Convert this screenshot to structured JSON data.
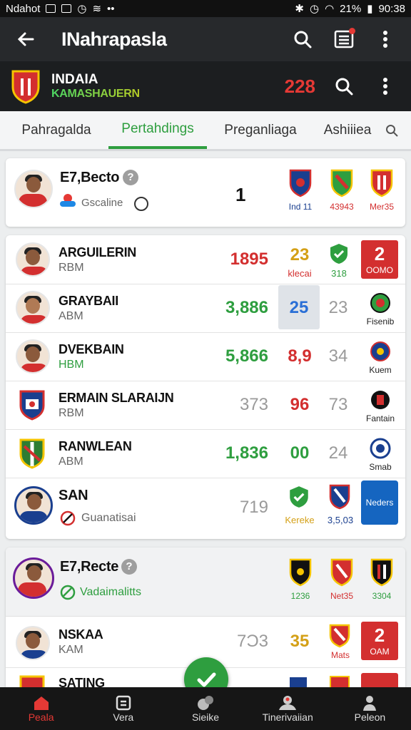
{
  "status_bar": {
    "left_text": "Ndahot",
    "battery": "21%",
    "time": "90:38"
  },
  "app_bar": {
    "title": "INahrapasla"
  },
  "team_header": {
    "line1": "INDAIA",
    "line2": "KAMASHAUERN",
    "score": "228"
  },
  "tabs": [
    {
      "label": "Pahragalda",
      "active": false
    },
    {
      "label": "Pertahdings",
      "active": true
    },
    {
      "label": "Preganliaga",
      "active": false
    },
    {
      "label": "Ashiiiea",
      "active": false
    }
  ],
  "card1": {
    "title": "E7,Becto",
    "status": "Gscaline",
    "count": "1",
    "badges": [
      {
        "caption": "Ind 11",
        "color": "#1a3f8f"
      },
      {
        "caption": "43943",
        "color": "#d32f2f"
      },
      {
        "caption": "Mer35",
        "color": "#d32f2f"
      }
    ]
  },
  "players": [
    {
      "name": "ARGUILERIN",
      "team": "RBM",
      "stat1": "1895",
      "stat1_color": "#d32f2f",
      "stat2": "23",
      "stat2_color": "#d4a017",
      "stat2_caption": "klecai",
      "stat3_caption": "318",
      "badge_num": "2",
      "badge_label": "OOMO"
    },
    {
      "name": "GRAYBAII",
      "team": "ABM",
      "stat1": "3,886",
      "stat1_color": "#2e9e3f",
      "stat2": "25",
      "stat2_color": "#2a6fd6",
      "stat3": "23",
      "badge_caption": "Fisenib"
    },
    {
      "name": "DVEKBAIN",
      "team": "HBM",
      "stat1": "5,866",
      "stat1_color": "#2e9e3f",
      "stat2": "8,9",
      "stat2_color": "#d32f2f",
      "stat3": "34",
      "badge_caption": "Kuem"
    },
    {
      "name": "ERMAIN SLARAIJN",
      "team": "RBM",
      "stat1": "373",
      "stat1_color": "#9a9a9a",
      "stat2": "96",
      "stat2_color": "#d32f2f",
      "stat3": "73",
      "badge_caption": "Fantain"
    },
    {
      "name": "RANWLEAN",
      "team": "ABM",
      "stat1": "1,836",
      "stat1_color": "#2e9e3f",
      "stat2": "00",
      "stat2_color": "#2e9e3f",
      "stat3": "24",
      "badge_caption": "Smab"
    },
    {
      "name": "SAN",
      "team": "Guanatisai",
      "stat1": "719",
      "stat1_color": "#9a9a9a",
      "stat2_caption": "Kereke",
      "stat3_caption": "3,5,03",
      "badge_label": "Neders"
    }
  ],
  "card2": {
    "title": "E7,Recte",
    "status": "Vadaimalitts",
    "badges": [
      {
        "caption": "1236",
        "color": "#111"
      },
      {
        "caption": "Net35",
        "color": "#d32f2f"
      },
      {
        "caption": "3304",
        "color": "#111"
      }
    ],
    "rows": [
      {
        "name": "NSKAA",
        "team": "KAM",
        "stat1": "7Ɔ3",
        "stat2": "35",
        "stat2_caption": "Mats",
        "badge_num": "2",
        "badge_label": "OAM"
      },
      {
        "name": "SATING",
        "team": "",
        "stat1": "",
        "stat2": ""
      }
    ]
  },
  "bottom_nav": [
    {
      "label": "Peala",
      "icon": "home-icon",
      "active": true
    },
    {
      "label": "Vera",
      "icon": "calendar-icon",
      "active": false
    },
    {
      "label": "Sieike",
      "icon": "ball-icon",
      "active": false
    },
    {
      "label": "Tinerivaiian",
      "icon": "profile-card-icon",
      "active": false
    },
    {
      "label": "Peleon",
      "icon": "person-icon",
      "active": false
    }
  ],
  "colors": {
    "accent": "#2e9e3f",
    "danger": "#d32f2f",
    "appbar": "#27292c"
  }
}
